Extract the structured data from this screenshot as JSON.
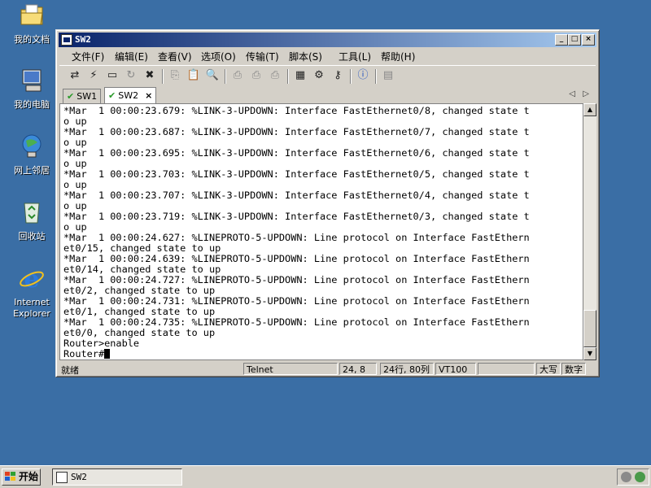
{
  "desktop": {
    "icons": [
      {
        "label": "我的文档",
        "icon": "my-documents-folder-icon"
      },
      {
        "label": "我的电脑",
        "icon": "my-computer-icon"
      },
      {
        "label": "网上邻居",
        "icon": "network-neighborhood-icon"
      },
      {
        "label": "回收站",
        "icon": "recycle-bin-icon"
      },
      {
        "label": "Internet Explorer",
        "icon": "internet-explorer-icon"
      }
    ]
  },
  "window": {
    "title": "SW2",
    "controls": {
      "minimize": "_",
      "maximize": "□",
      "close": "×"
    }
  },
  "menu": {
    "items": [
      "文件(F)",
      "编辑(E)",
      "查看(V)",
      "选项(O)",
      "传输(T)",
      "脚本(S)",
      "工具(L)",
      "帮助(H)"
    ]
  },
  "toolbar": {
    "icons": [
      "connect-icon",
      "quick-connect-icon",
      "connect-tab-icon",
      "reconnect-icon",
      "disconnect-icon",
      "copy-icon",
      "paste-icon",
      "find-icon",
      "print-icon",
      "print-setup-icon",
      "print-screen-icon",
      "session-options-icon",
      "global-options-icon",
      "keymap-icon",
      "help-icon",
      "sftp-icon"
    ]
  },
  "tabs": [
    {
      "label": "SW1",
      "active": false
    },
    {
      "label": "SW2",
      "active": true,
      "close": "×"
    }
  ],
  "tab_nav": {
    "prev": "◁",
    "next": "▷"
  },
  "terminal": {
    "lines": [
      "*Mar  1 00:00:23.679: %LINK-3-UPDOWN: Interface FastEthernet0/8, changed state t",
      "o up",
      "*Mar  1 00:00:23.687: %LINK-3-UPDOWN: Interface FastEthernet0/7, changed state t",
      "o up",
      "*Mar  1 00:00:23.695: %LINK-3-UPDOWN: Interface FastEthernet0/6, changed state t",
      "o up",
      "*Mar  1 00:00:23.703: %LINK-3-UPDOWN: Interface FastEthernet0/5, changed state t",
      "o up",
      "*Mar  1 00:00:23.707: %LINK-3-UPDOWN: Interface FastEthernet0/4, changed state t",
      "o up",
      "*Mar  1 00:00:23.719: %LINK-3-UPDOWN: Interface FastEthernet0/3, changed state t",
      "o up",
      "*Mar  1 00:00:24.627: %LINEPROTO-5-UPDOWN: Line protocol on Interface FastEthern",
      "et0/15, changed state to up",
      "*Mar  1 00:00:24.639: %LINEPROTO-5-UPDOWN: Line protocol on Interface FastEthern",
      "et0/14, changed state to up",
      "*Mar  1 00:00:24.727: %LINEPROTO-5-UPDOWN: Line protocol on Interface FastEthern",
      "et0/2, changed state to up",
      "*Mar  1 00:00:24.731: %LINEPROTO-5-UPDOWN: Line protocol on Interface FastEthern",
      "et0/1, changed state to up",
      "*Mar  1 00:00:24.735: %LINEPROTO-5-UPDOWN: Line protocol on Interface FastEthern",
      "et0/0, changed state to up",
      "Router>enable"
    ],
    "prompt": "Router#"
  },
  "statusbar": {
    "ready": "就绪",
    "protocol": "Telnet",
    "cursor_pos": "24,  8",
    "dimensions": "24行, 80列",
    "emulation": "VT100",
    "empty": "",
    "caps": "大写",
    "num": "数字"
  },
  "taskbar": {
    "start_label": "开始",
    "task_label": "SW2"
  },
  "colors": {
    "desktop": "#3a6ea5",
    "title_active_start": "#0a246a",
    "title_active_end": "#a6caf0",
    "chrome": "#d4d0c8"
  }
}
